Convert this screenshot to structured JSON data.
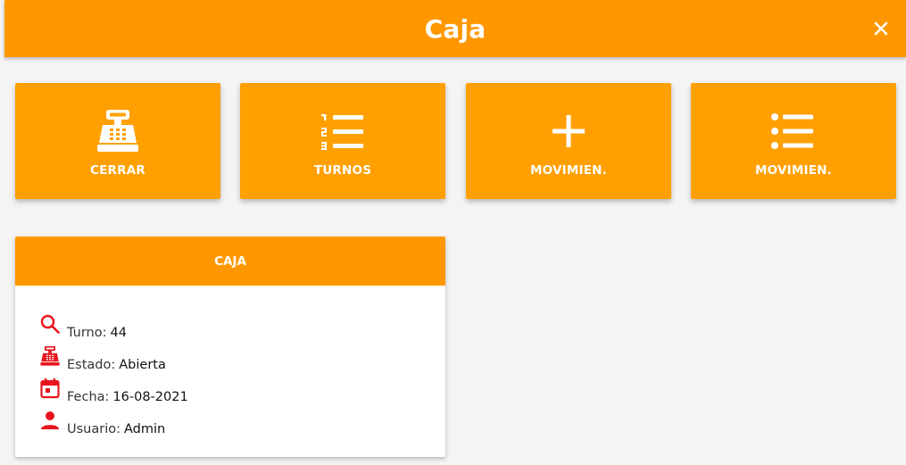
{
  "header": {
    "title": "Caja",
    "close_icon": "close-icon"
  },
  "tiles": [
    {
      "label": "CERRAR",
      "icon": "cash-register-icon"
    },
    {
      "label": "TURNOS",
      "icon": "numbered-list-icon"
    },
    {
      "label": "MOVIMIEN.",
      "icon": "plus-icon"
    },
    {
      "label": "MOVIMIEN.",
      "icon": "bulleted-list-icon"
    }
  ],
  "card": {
    "title": "CAJA",
    "rows": [
      {
        "label": "Turno:",
        "value": "44",
        "icon": "search-icon"
      },
      {
        "label": "Estado:",
        "value": "Abierta",
        "icon": "cash-register-icon"
      },
      {
        "label": "Fecha:",
        "value": "16-08-2021",
        "icon": "calendar-icon"
      },
      {
        "label": "Usuario:",
        "value": "Admin",
        "icon": "user-icon"
      }
    ]
  },
  "colors": {
    "header": "#ff9800",
    "tile": "#ffa000",
    "icon_red": "#e8141c",
    "background": "#f4f4f4"
  }
}
